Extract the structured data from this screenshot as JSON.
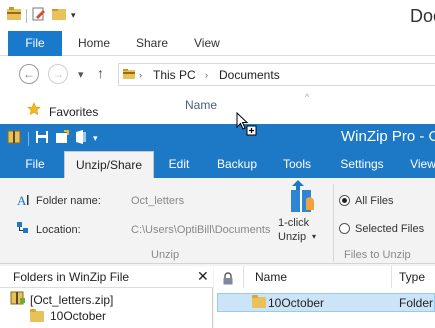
{
  "explorer": {
    "title": "Doc",
    "file_tab": "File",
    "tabs": [
      "Home",
      "Share",
      "View"
    ],
    "address": {
      "segments": [
        "This PC",
        "Documents"
      ]
    },
    "favorites_label": "Favorites",
    "column_name": "Name"
  },
  "winzip": {
    "title": "WinZip Pro - O",
    "file_tab": "File",
    "tabs": [
      "Unzip/Share",
      "Edit",
      "Backup",
      "Tools",
      "Settings",
      "View"
    ],
    "folder_name_label": "Folder name:",
    "folder_name_value": "Oct_letters",
    "location_label": "Location:",
    "location_value": "C:\\Users\\OptiBill\\Documents",
    "one_click_label_1": "1-click",
    "one_click_label_2": "Unzip",
    "unzip_group": "Unzip",
    "radio_all": "All Files",
    "radio_selected": "Selected Files",
    "files_group": "Files to Unzip",
    "selected_radio": "All Files",
    "left_pane_title": "Folders in WinZip File",
    "tree": [
      "[Oct_letters.zip]",
      "10October"
    ],
    "columns": [
      "Name",
      "Type"
    ],
    "rows": [
      {
        "name": "10October",
        "type": "Folder"
      }
    ]
  },
  "colors": {
    "accent": "#1d79c6",
    "selection": "#cce4f7",
    "folder": "#e8c15a"
  }
}
